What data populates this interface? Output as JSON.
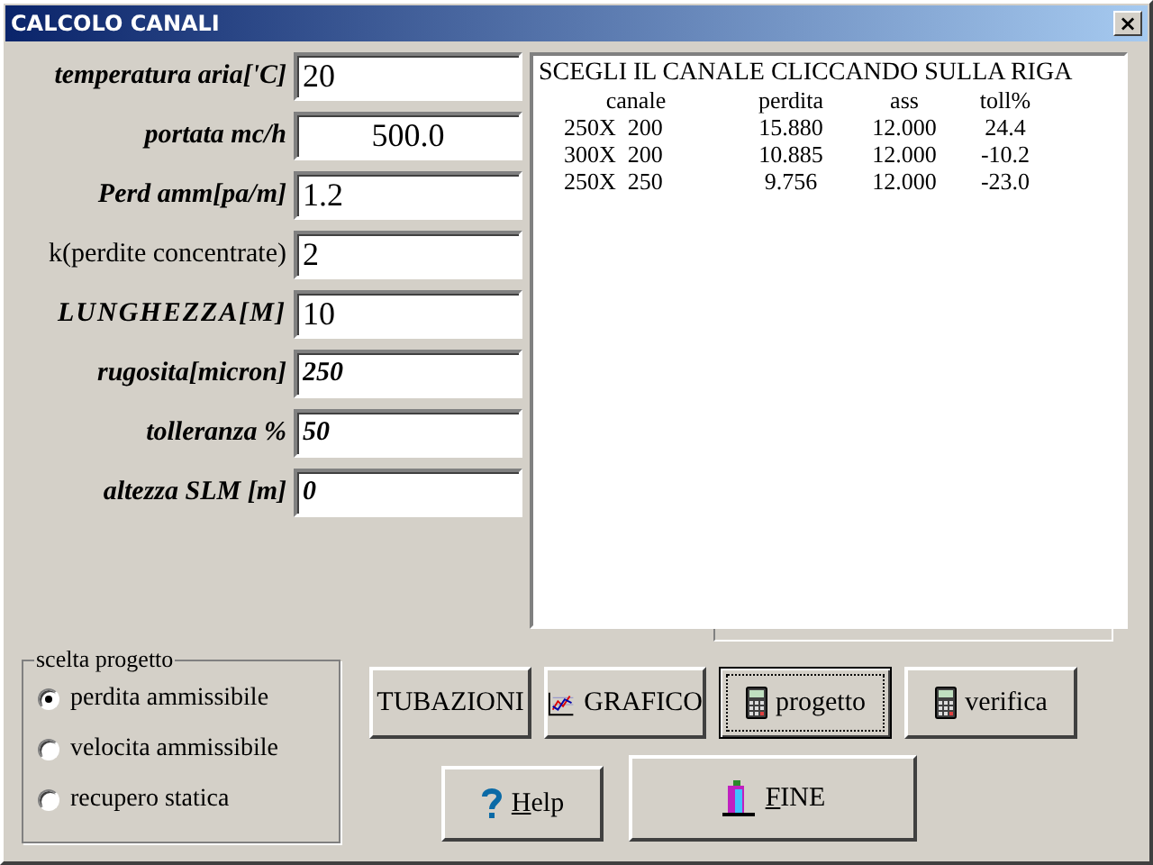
{
  "window": {
    "title": "CALCOLO CANALI",
    "close": "×"
  },
  "fields": [
    {
      "label": "temperatura aria['C]",
      "value": "20"
    },
    {
      "label": "portata mc/h",
      "value": "500.0"
    },
    {
      "label": "Perd amm[pa/m]",
      "value": "1.2"
    },
    {
      "label": "k(perdite concentrate)",
      "value": "2"
    },
    {
      "label": "LUNGHEZZA[M]",
      "value": "10"
    },
    {
      "label": "rugosita[micron]",
      "value": "250"
    },
    {
      "label": "tolleranza %",
      "value": "50"
    },
    {
      "label": "altezza SLM [m]",
      "value": "0"
    }
  ],
  "results": {
    "heading": "SCEGLI IL CANALE CLICCANDO SULLA RIGA",
    "columns": [
      "canale",
      "perdita",
      "ass",
      "toll%"
    ],
    "rows": [
      [
        "250X  200",
        "15.880",
        "12.000",
        "24.4"
      ],
      [
        "300X  200",
        "10.885",
        "12.000",
        "-10.2"
      ],
      [
        "250X  250",
        "9.756",
        "12.000",
        "-23.0"
      ]
    ]
  },
  "project_choice": {
    "title": "scelta progetto",
    "options": [
      {
        "label": "perdita ammissibile",
        "selected": true
      },
      {
        "label": "velocita ammissibile",
        "selected": false
      },
      {
        "label": "recupero statica",
        "selected": false
      }
    ]
  },
  "buttons": [
    {
      "label": "TUBAZIONI",
      "focused": false
    },
    {
      "label": "GRAFICO",
      "focused": false
    },
    {
      "label": "progetto",
      "focused": true
    },
    {
      "label": "verifica",
      "focused": false
    }
  ],
  "bottom_buttons": [
    {
      "label": "Help"
    },
    {
      "label": "FINE"
    }
  ]
}
